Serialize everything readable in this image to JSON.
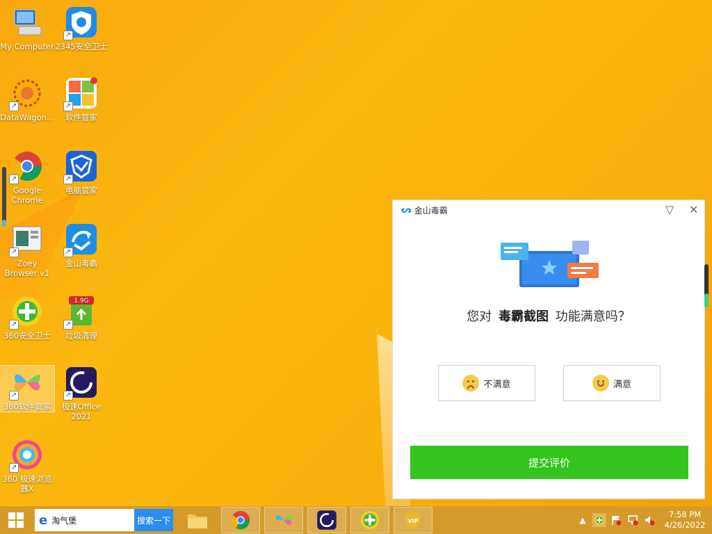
{
  "desktop": {
    "icons": [
      {
        "label": "My Computer"
      },
      {
        "label": "2345安全卫士"
      },
      {
        "label": "DataWagon..."
      },
      {
        "label": "软件管家"
      },
      {
        "label": "Google Chrome"
      },
      {
        "label": "电脑管家"
      },
      {
        "label": "Zoey Browser v1"
      },
      {
        "label": "金山毒霸"
      },
      {
        "label": "360安全卫士"
      },
      {
        "label": "垃圾清理"
      },
      {
        "label": "360软件管家"
      },
      {
        "label": "极速Office 2021"
      },
      {
        "label": "360 极速浏览器X"
      }
    ],
    "badge_1_9g": "1.9G"
  },
  "popup": {
    "title": "金山毒霸",
    "question_prefix": "您对",
    "question_feature": "毒霸截图",
    "question_suffix": "功能满意吗？",
    "dissatisfied_label": "不满意",
    "satisfied_label": "满意",
    "submit_label": "提交评价"
  },
  "taskbar": {
    "search_text": "淘气堡",
    "search_button": "搜索一下",
    "time": "7:58 PM",
    "date": "4/26/2022"
  },
  "colors": {
    "accent_green": "#33c41e",
    "search_blue": "#2a8ef0",
    "wallpaper": "#f9b40e",
    "taskbar": "#d59b2a"
  }
}
